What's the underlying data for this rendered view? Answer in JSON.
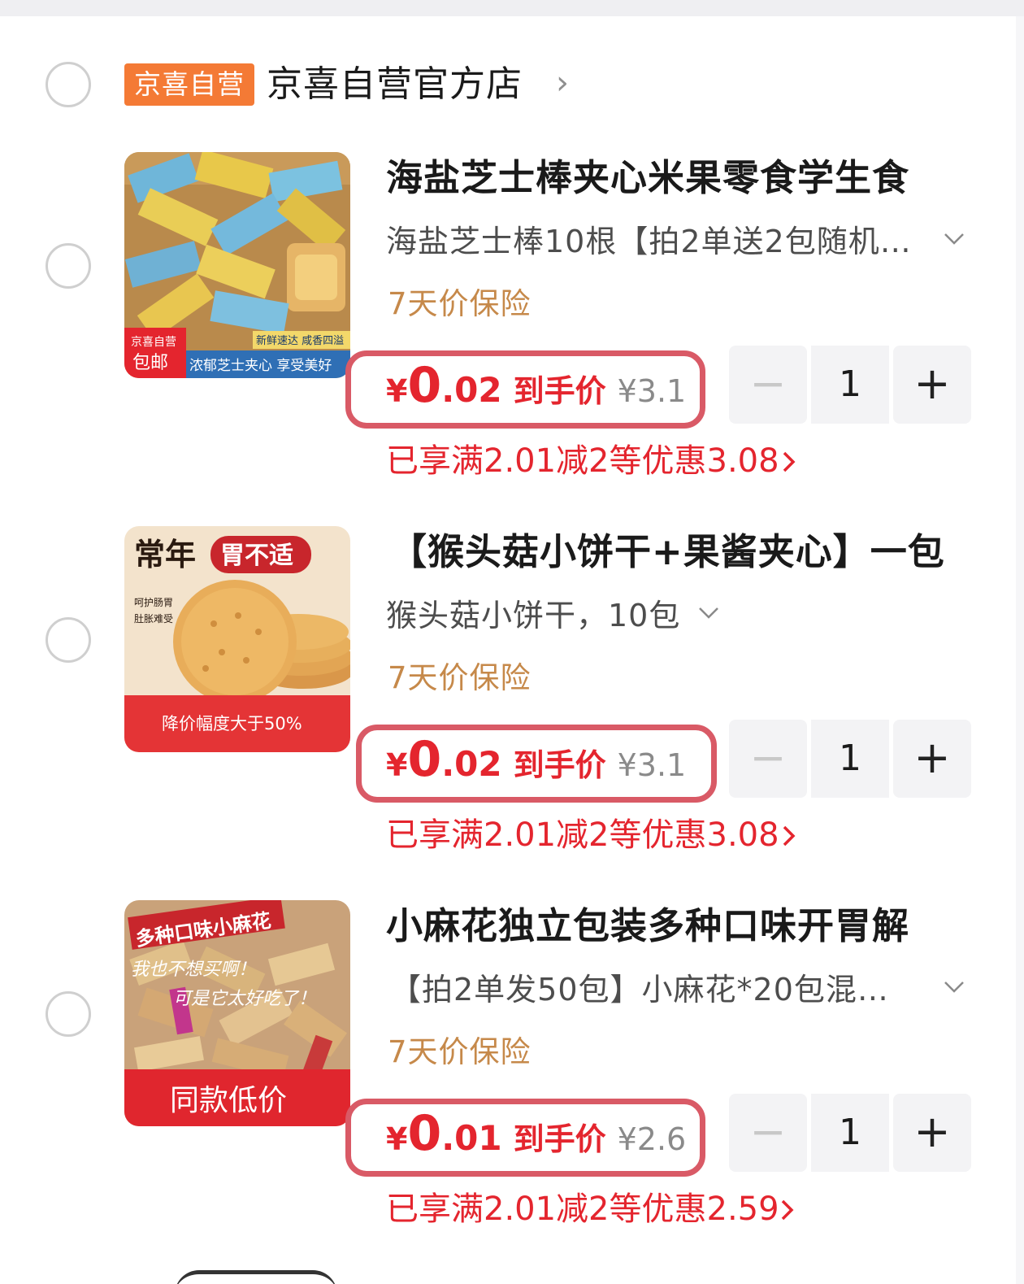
{
  "store": {
    "badge": "京喜自营",
    "name": "京喜自营官方店",
    "chevron": "›"
  },
  "items": [
    {
      "title": "海盐芝士棒夹心米果零食学生食",
      "variant": "海盐芝士棒10根【拍2单送2包随机…",
      "insurance": "7天价保险",
      "price_yen": "¥",
      "price_int": "0",
      "price_dec": ".02",
      "price_label": "到手价",
      "original_price": "¥3.1",
      "quantity": "1",
      "promo": "已享满2.01减2等优惠3.08",
      "image": {
        "corner_tag_top": "京喜自营",
        "corner_tag_bottom": "包邮",
        "banner_right_top": "新鲜速达 咸香四溢",
        "banner_right": "浓郁芝士夹心 享受美好"
      }
    },
    {
      "title": "【猴头菇小饼干+果酱夹心】一包",
      "variant": "猴头菇小饼干，10包",
      "insurance": "7天价保险",
      "price_yen": "¥",
      "price_int": "0",
      "price_dec": ".02",
      "price_label": "到手价",
      "original_price": "¥3.1",
      "quantity": "1",
      "promo": "已享满2.01减2等优惠3.08",
      "image": {
        "headline": "常年",
        "headline_tag": "胃不适",
        "side_line1": "呵护肠胃",
        "side_line2": "肚胀难受",
        "banner": "降价幅度大于50%"
      }
    },
    {
      "title": "小麻花独立包装多种口味开胃解",
      "variant": "【拍2单发50包】小麻花*20包混…",
      "insurance": "7天价保险",
      "price_yen": "¥",
      "price_int": "0",
      "price_dec": ".01",
      "price_label": "到手价",
      "original_price": "¥2.6",
      "quantity": "1",
      "promo": "已享满2.01减2等优惠2.59",
      "image": {
        "headline": "多种口味小麻花",
        "line1": "我也不想买啊！",
        "line2": "可是它太好吃了！",
        "banner": "同款低价"
      }
    }
  ],
  "stepper": {
    "minus": "−",
    "plus": "+"
  },
  "colors": {
    "accent_red": "#e4252e",
    "badge_orange": "#f47a35",
    "insurance_gold": "#c6894a",
    "highlight_box": "#d95a66"
  }
}
